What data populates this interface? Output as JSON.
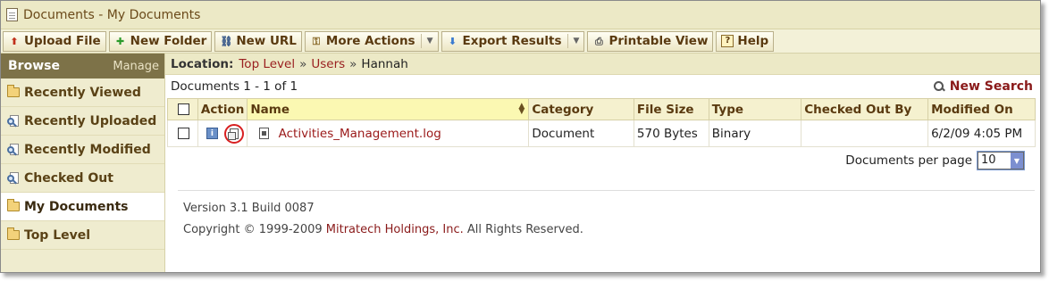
{
  "window": {
    "title": "Documents - My Documents"
  },
  "toolbar": {
    "upload": "Upload File",
    "new_folder": "New Folder",
    "new_url": "New URL",
    "more_actions": "More Actions",
    "export_results": "Export Results",
    "printable_view": "Printable View",
    "help": "Help"
  },
  "sidebar": {
    "browse": "Browse",
    "manage": "Manage",
    "items": [
      {
        "label": "Recently Viewed",
        "icon": "folder-icon"
      },
      {
        "label": "Recently Uploaded",
        "icon": "search-doc-icon"
      },
      {
        "label": "Recently Modified",
        "icon": "search-doc-icon"
      },
      {
        "label": "Checked Out",
        "icon": "search-doc-icon"
      },
      {
        "label": "My Documents",
        "icon": "folder-icon",
        "active": true
      },
      {
        "label": "Top Level",
        "icon": "folder-icon"
      }
    ]
  },
  "location": {
    "label": "Location:",
    "crumbs": [
      "Top Level",
      "Users",
      "Hannah"
    ],
    "separator": "»"
  },
  "list": {
    "count_text": "Documents 1 - 1 of 1",
    "new_search": "New Search",
    "columns": {
      "action": "Action",
      "name": "Name",
      "category": "Category",
      "file_size": "File Size",
      "type": "Type",
      "checked_out_by": "Checked Out By",
      "modified_on": "Modified On"
    },
    "rows": [
      {
        "name": "Activities_Management.log",
        "category": "Document",
        "file_size": "570 Bytes",
        "type": "Binary",
        "checked_out_by": "",
        "modified_on": "6/2/09 4:05 PM"
      }
    ],
    "per_page_label": "Documents per page",
    "per_page_value": "10"
  },
  "footer": {
    "version": "Version 3.1 Build 0087",
    "copyright_prefix": "Copyright © 1999-2009 ",
    "company": "Mitratech Holdings, Inc.",
    "copyright_suffix": " All Rights Reserved."
  },
  "colors": {
    "accent_link": "#9a1818",
    "sidebar_header": "#7d7248",
    "toolbar_bg": "#f3f1d8",
    "highlight_circle": "#d82020"
  }
}
